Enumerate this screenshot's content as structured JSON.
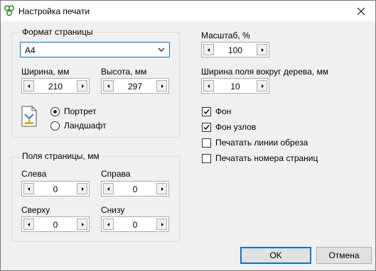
{
  "window": {
    "title": "Настройка печати"
  },
  "page_format": {
    "legend": "Формат страницы",
    "paper": "A4",
    "width_label": "Ширина, мм",
    "width_value": "210",
    "height_label": "Высота, мм",
    "height_value": "297",
    "orientation": {
      "portrait": "Портрет",
      "landscape": "Ландшафт",
      "selected": "portrait"
    }
  },
  "margins": {
    "legend": "Поля страницы, мм",
    "left_label": "Слева",
    "left_value": "0",
    "right_label": "Справа",
    "right_value": "0",
    "top_label": "Сверху",
    "top_value": "0",
    "bottom_label": "Снизу",
    "bottom_value": "0"
  },
  "scale": {
    "label": "Масштаб, %",
    "value": "100"
  },
  "tree_margin": {
    "label": "Ширина поля вокруг дерева, мм",
    "value": "10"
  },
  "options": [
    {
      "label": "Фон",
      "checked": true
    },
    {
      "label": "Фон узлов",
      "checked": true
    },
    {
      "label": "Печатать линии обреза",
      "checked": false
    },
    {
      "label": "Печатать номера страниц",
      "checked": false
    }
  ],
  "buttons": {
    "ok": "OK",
    "cancel": "Отмена"
  },
  "colors": {
    "accent": "#0078d7",
    "face": "#f0f0f0"
  },
  "icons": {
    "app": "tree-app-icon",
    "orientation": "page-orientation-icon"
  }
}
